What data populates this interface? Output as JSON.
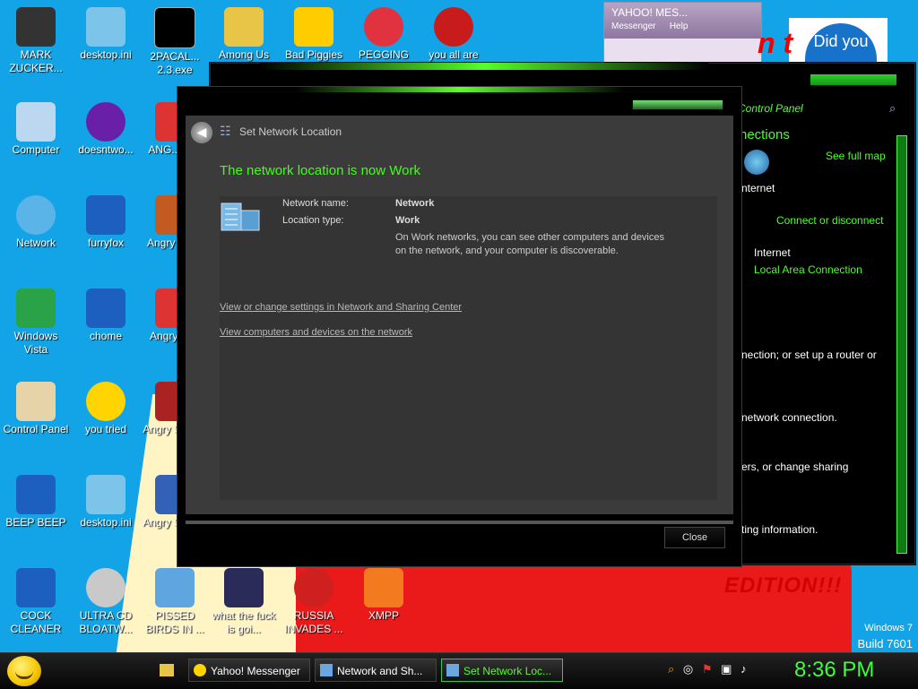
{
  "desktop": {
    "icons": [
      {
        "label": "MARK ZUCKER...",
        "icon": "person-icon"
      },
      {
        "label": "desktop.ini",
        "icon": "file-icon"
      },
      {
        "label": "2PACAL... 2.3.exe",
        "icon": "console-icon"
      },
      {
        "label": "Among Us",
        "icon": "game-icon"
      },
      {
        "label": "Bad Piggies",
        "icon": "pig-icon"
      },
      {
        "label": "PEGGING",
        "icon": "peggle-icon"
      },
      {
        "label": "you all are",
        "icon": "devcpp-icon"
      },
      {
        "label": "Computer",
        "icon": "computer-icon"
      },
      {
        "label": "doesntwo...",
        "icon": "yahoo-icon"
      },
      {
        "label": "ANG... BIR",
        "icon": "angrybirds-icon"
      },
      {
        "label": "Network",
        "icon": "network-icon"
      },
      {
        "label": "furryfox",
        "icon": "shortcut-icon"
      },
      {
        "label": "Angry Seas",
        "icon": "angrybirds-icon"
      },
      {
        "label": "Windows Vista",
        "icon": "recycle-icon"
      },
      {
        "label": "chome",
        "icon": "shortcut-icon"
      },
      {
        "label": "Angry Spa",
        "icon": "angrybirds-icon"
      },
      {
        "label": "Control Panel",
        "icon": "control-panel-icon"
      },
      {
        "label": "you tried",
        "icon": "star-icon"
      },
      {
        "label": "Angry Star W",
        "icon": "angrybirds-icon"
      },
      {
        "label": "BEEP BEEP",
        "icon": "shortcut-icon"
      },
      {
        "label": "desktop.ini",
        "icon": "file-icon"
      },
      {
        "label": "Angry Star W",
        "icon": "angrybirds-icon"
      },
      {
        "label": "COCK CLEANER",
        "icon": "shortcut-icon"
      },
      {
        "label": "ULTRA CD BLOATW...",
        "icon": "cd-icon"
      },
      {
        "label": "PISSED BIRDS IN ...",
        "icon": "angrybirds-icon"
      },
      {
        "label": "what the fuck is goi...",
        "icon": "angrybirds-icon"
      },
      {
        "label": "RUSSIA INVADES ...",
        "icon": "radiation-icon"
      },
      {
        "label": "XMPP",
        "icon": "xampp-icon"
      }
    ],
    "wallpaper_text": "EDITION!!!",
    "windows_edition": "Windows 7",
    "build": "Build 7601"
  },
  "yahoo_window": {
    "title": "YAHOO! MES...",
    "menu": [
      "Messenger",
      "Help"
    ]
  },
  "control_panel": {
    "address": "Control Panel",
    "heading": "nections",
    "see_full_map": "See full map",
    "internet_label": "nternet",
    "connect_link": "Connect or disconnect",
    "internet2": "Internet",
    "local_area": "Local Area Connection",
    "text1": "nection; or set up a router or",
    "text2": "network connection.",
    "text3": "ers, or change sharing",
    "text4": "ting information."
  },
  "dialog": {
    "title": "Set Network Location",
    "heading": "The network location is now Work",
    "network_name_label": "Network name:",
    "network_name_value": "Network",
    "location_type_label": "Location type:",
    "location_type_value": "Work",
    "description": "On Work networks, you can see other computers and devices on the network, and your computer is discoverable.",
    "link1": "View or change settings in Network and Sharing Center",
    "link2": "View computers and devices on the network",
    "close_button": "Close"
  },
  "taskbar": {
    "items": [
      {
        "label": "Yahoo! Messenger",
        "icon": "yahoo-icon"
      },
      {
        "label": "Network and Sh...",
        "icon": "network-icon"
      },
      {
        "label": "Set Network Loc...",
        "icon": "network-icon"
      }
    ],
    "clock": "8:36 PM"
  }
}
